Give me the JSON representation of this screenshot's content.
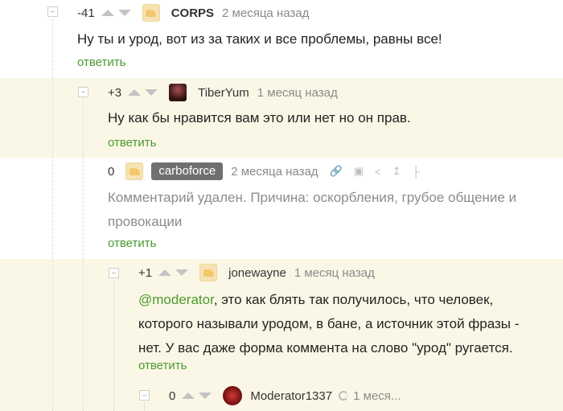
{
  "comments": [
    {
      "rating": "-41",
      "author": "CORPS",
      "time": "2 месяца назад",
      "text": "Ну ты и урод, вот из за таких и все проблемы, равны все!",
      "reply": "ответить"
    },
    {
      "rating": "+3",
      "author": "TiberYum",
      "time": "1 месяц назад",
      "text": "Ну как бы нравится вам это или нет но он прав.",
      "reply": "ответить"
    },
    {
      "rating": "0",
      "author": "carboforce",
      "time": "2 месяца назад",
      "text": "Комментарий удален. Причина: оскорбления, грубое общение и провокации",
      "reply": "ответить"
    },
    {
      "rating": "+1",
      "author": "jonewayne",
      "time": "1 месяц назад",
      "mention": "@moderator",
      "text": ", это как блять так получилось, что человек, которого называли уродом, в бане, а источник этой фразы - нет. У вас даже форма коммента на слово \"урод\" ругается.",
      "reply": "ответить"
    },
    {
      "rating": "0",
      "author": "Moderator1337",
      "time": "1 меся..."
    }
  ],
  "icons": {
    "link": "link-icon",
    "save": "save-icon",
    "share": "share-icon",
    "top": "arrow-top-icon",
    "branch": "branch-icon"
  },
  "colors": {
    "highlight_background": "#fbf7e6",
    "link_green": "#4a9a2e",
    "deleted_text": "#8c8c8c",
    "author_tag": "#707070"
  }
}
